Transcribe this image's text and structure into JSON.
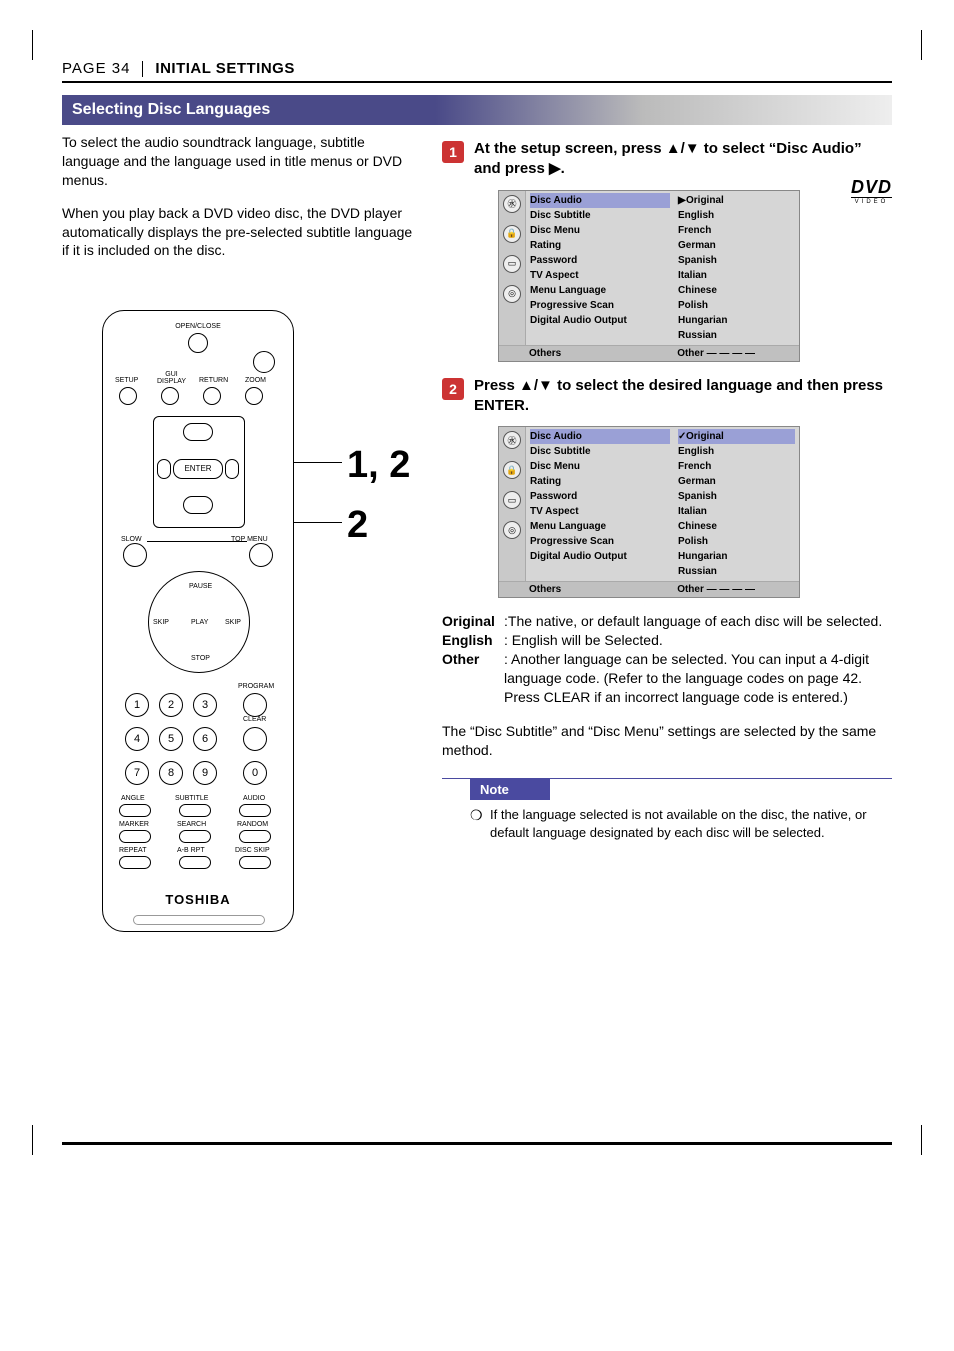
{
  "header": {
    "page_label": "PAGE 34",
    "section": "INITIAL SETTINGS"
  },
  "title_bar": "Selecting Disc Languages",
  "dvd_logo": {
    "top": "DVD",
    "bottom": "VIDEO"
  },
  "intro": {
    "p1": "To select the audio soundtrack language, subtitle language and the language used in title menus or DVD menus.",
    "p2": "When you play back a DVD video disc, the DVD player automatically displays the pre-selected subtitle language if it is included on the disc."
  },
  "remote": {
    "open_close": "OPEN/CLOSE",
    "setup": "SETUP",
    "gui_display": "GUI\nDISPLAY",
    "return": "RETURN",
    "zoom": "ZOOM",
    "enter": "ENTER",
    "slow": "SLOW",
    "top_menu": "TOP MENU",
    "pause": "PAUSE",
    "skip_prev": "SKIP",
    "play": "PLAY",
    "skip_next": "SKIP",
    "stop": "STOP",
    "program": "PROGRAM",
    "clear": "CLEAR",
    "angle": "ANGLE",
    "subtitle": "SUBTITLE",
    "audio": "AUDIO",
    "marker": "MARKER",
    "search": "SEARCH",
    "random": "RANDOM",
    "repeat": "REPEAT",
    "ab_rpt": "A-B RPT",
    "disc_skip": "DISC SKIP",
    "brand": "TOSHIBA",
    "digits": [
      "1",
      "2",
      "3",
      "4",
      "5",
      "6",
      "7",
      "8",
      "9",
      "0"
    ]
  },
  "callouts": {
    "c1": "1, 2",
    "c2": "2"
  },
  "step1": {
    "num": "1",
    "text_a": "At the setup screen, press ",
    "text_b": " to select “Disc Audio” and press ",
    "text_c": "."
  },
  "step2": {
    "num": "2",
    "text_a": "Press ",
    "text_b": " to select the desired language and then press ENTER."
  },
  "osd_left": [
    "Disc Audio",
    "Disc Subtitle",
    "Disc Menu",
    "Rating",
    "Password",
    "TV Aspect",
    "Menu Language",
    "Progressive Scan",
    "Digital Audio Output"
  ],
  "osd_right": [
    "Original",
    "English",
    "French",
    "German",
    "Spanish",
    "Italian",
    "Chinese",
    "Polish",
    "Hungarian",
    "Russian"
  ],
  "osd_footer": {
    "label": "Others",
    "value": "Other  — — — —"
  },
  "osd1_marker": "▶",
  "osd2_marker": "✓",
  "definitions": {
    "original_term": "Original",
    "original_text": ":The native, or default language of each disc will be selected.",
    "english_term": "English",
    "english_text": ": English will be Selected.",
    "other_term": "Other",
    "other_text": ":   Another language can be selected. You can input a 4-digit language code. (Refer to the language codes on page 42. Press CLEAR if an incorrect language code is entered.)"
  },
  "closing": "The “Disc Subtitle” and “Disc Menu” settings are selected by the same method.",
  "note": {
    "label": "Note",
    "bullet": "❍",
    "text": "If the language selected is not available on the disc, the native, or default language designated by each disc will be selected."
  }
}
